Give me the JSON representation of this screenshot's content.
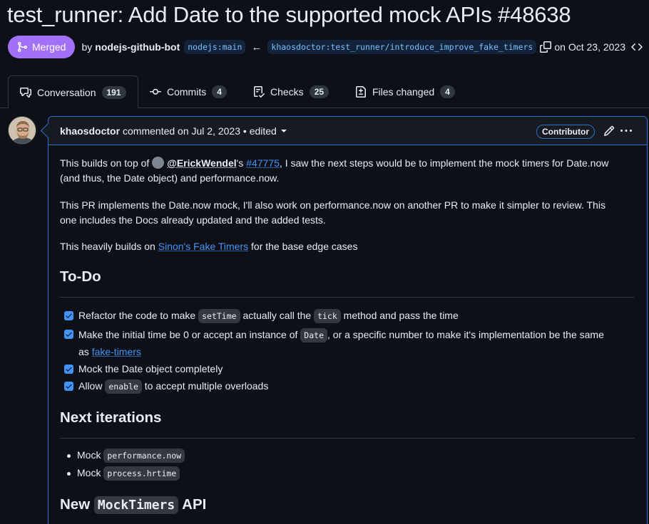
{
  "pr": {
    "title": "test_runner: Add Date to the supported mock APIs #48638",
    "state_label": "Merged",
    "by_label": "by",
    "author": "nodejs-github-bot",
    "base_branch": "nodejs:main",
    "arrow": "←",
    "head_branch": "khaosdoctor:test_runner/introduce_improve_fake_timers",
    "date_label": "on Oct 23, 2023"
  },
  "tabs": [
    {
      "label": "Conversation",
      "count": "191"
    },
    {
      "label": "Commits",
      "count": "4"
    },
    {
      "label": "Checks",
      "count": "25"
    },
    {
      "label": "Files changed",
      "count": "4"
    }
  ],
  "comment": {
    "author": "khaosdoctor",
    "meta": "commented on Jul 2, 2023 • edited",
    "badge": "Contributor",
    "p1": {
      "prefix": "This builds on top of",
      "mention": "@ErickWendel",
      "apos": "'s",
      "pr_link": "#47775",
      "rest_line1": ", I saw the next steps would be to implement the mock timers for Date.now",
      "line2": "(and thus, the Date object) and performance.now."
    },
    "p2": {
      "line1": "This PR implements the Date.now mock, I'll also work on performance.now on another PR to make it simpler to review. This",
      "line2": "one includes the Docs already updated and the added tests."
    },
    "p3": {
      "prefix": "This heavily builds on",
      "link": "Sinon's Fake Timers",
      "suffix": "for the base edge cases"
    },
    "todo_heading": "To-Do",
    "tasks": {
      "t1": {
        "a": "Refactor the code to make",
        "code1": "setTime",
        "b": "actually call the",
        "code2": "tick",
        "c": "method and pass the time"
      },
      "t2": {
        "a": "Make the initial time be 0 or accept an instance of",
        "code1": "Date",
        "b": ", or a specific number to make it's implementation be the same",
        "line2_prefix": "as",
        "link": "fake-timers"
      },
      "t3": {
        "a": "Mock the Date object completely"
      },
      "t4": {
        "a": "Allow",
        "code1": "enable",
        "b": "to accept multiple overloads"
      }
    },
    "next_heading": "Next iterations",
    "next_items": [
      {
        "prefix": "Mock",
        "code": "performance.now"
      },
      {
        "prefix": "Mock",
        "code": "process.hrtime"
      }
    ],
    "new_heading": {
      "prefix": "New",
      "code": "MockTimers",
      "suffix": "API"
    }
  },
  "colors": {
    "merged": "#a371f7",
    "accent_blue": "#4493f8",
    "border_blue": "#316dca",
    "background": "#0d1117"
  }
}
